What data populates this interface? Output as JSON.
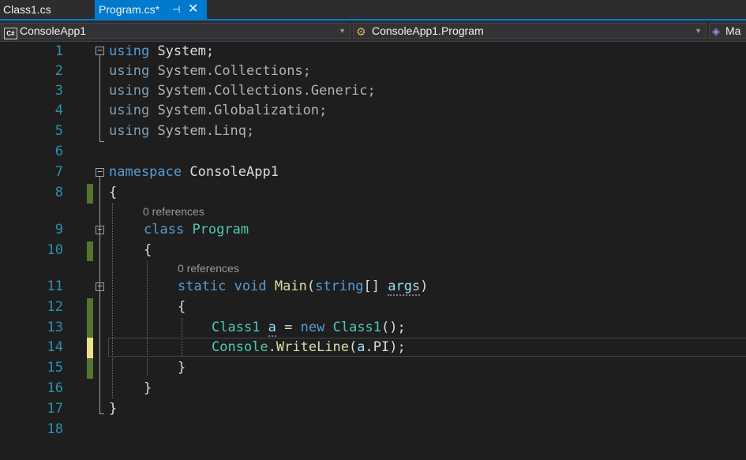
{
  "tabs": [
    {
      "label": "Class1.cs",
      "active": false
    },
    {
      "label": "Program.cs*",
      "active": true,
      "pin_icon": "pin-icon",
      "close_icon": "close-icon"
    }
  ],
  "navbar": {
    "project": "ConsoleApp1",
    "type": "ConsoleApp1.Program",
    "member": "Ma"
  },
  "editor": {
    "line_numbers": [
      "1",
      "2",
      "3",
      "4",
      "5",
      "6",
      "7",
      "8",
      "9",
      "10",
      "11",
      "12",
      "13",
      "14",
      "15",
      "16",
      "17",
      "18"
    ],
    "codelens": {
      "class_refs": "0 references",
      "main_refs": "0 references"
    },
    "lines": {
      "l1": [
        "using",
        " ",
        "System",
        ";"
      ],
      "l2": [
        "using",
        " ",
        "System.Collections",
        ";"
      ],
      "l3": [
        "using",
        " ",
        "System.Collections.Generic",
        ";"
      ],
      "l4": [
        "using",
        " ",
        "System.Globalization",
        ";"
      ],
      "l5": [
        "using",
        " ",
        "System.Linq",
        ";"
      ],
      "l7": [
        "namespace",
        " ",
        "ConsoleApp1"
      ],
      "l8": "{",
      "l9": [
        "class",
        " ",
        "Program"
      ],
      "l10": "{",
      "l11": [
        "static",
        " ",
        "void",
        " ",
        "Main",
        "(",
        "string",
        "[] ",
        "args",
        ")"
      ],
      "l12": "{",
      "l13": [
        "Class1",
        " ",
        "a",
        " = ",
        "new",
        " ",
        "Class1",
        "();"
      ],
      "l14": [
        "Console",
        ".",
        "WriteLine",
        "(",
        "a",
        ".PI);"
      ],
      "l15": "}",
      "l16": "}",
      "l17": "}"
    },
    "colors": {
      "keyword": "#569cd6",
      "type": "#4ec9b0",
      "method": "#dcdcaa",
      "identifier": "#9cdcfe",
      "line_number": "#2b91af",
      "change_saved": "#577430",
      "change_unsaved": "#efe08a",
      "tab_active": "#007acc"
    }
  }
}
